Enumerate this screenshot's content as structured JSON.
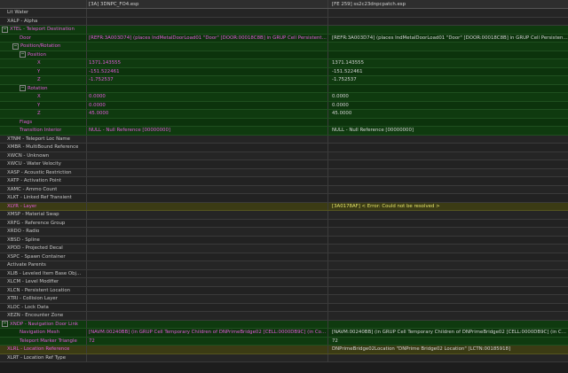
{
  "header": {
    "col1": "[3A] 3DNPC_FO4.esp",
    "col2": "[FE 259] ss2c23dnpcpatch.esp"
  },
  "rows": {
    "r0": {
      "label": "Lit Water",
      "v1": "",
      "v2": ""
    },
    "r1": {
      "label": "XALP - Alpha",
      "v1": "",
      "v2": ""
    },
    "r2": {
      "label": "XTEL - Teleport Destination",
      "v1": "",
      "v2": ""
    },
    "r3": {
      "label": "Door",
      "v1": "[REFR:3A003D74] (places IndMetalDoorLoad01 \"Door\" [DOOR:00018C8B] in GRUP Cell Persistent Chil...",
      "v2": "[REFR:3A003D74] (places IndMetalDoorLoad01 \"Door\" [DOOR:00018C8B] in GRUP Cell Persistent Childr..."
    },
    "r4": {
      "label": "Position/Rotation",
      "v1": "",
      "v2": ""
    },
    "r5": {
      "label": "Position",
      "v1": "",
      "v2": ""
    },
    "r6": {
      "label": "X",
      "v1": "1371.143555",
      "v2": "1371.143555"
    },
    "r7": {
      "label": "Y",
      "v1": "-151.522461",
      "v2": "-151.522461"
    },
    "r8": {
      "label": "Z",
      "v1": "-1.752537",
      "v2": "-1.752537"
    },
    "r9": {
      "label": "Rotation",
      "v1": "",
      "v2": ""
    },
    "r10": {
      "label": "X",
      "v1": "0.0000",
      "v2": "0.0000"
    },
    "r11": {
      "label": "Y",
      "v1": "0.0000",
      "v2": "0.0000"
    },
    "r12": {
      "label": "Z",
      "v1": "45.0000",
      "v2": "45.0000"
    },
    "r13": {
      "label": "Flags",
      "v1": "",
      "v2": ""
    },
    "r14": {
      "label": "Transition Interior",
      "v1": "NULL - Null Reference [00000000]",
      "v2": "NULL - Null Reference [00000000]"
    },
    "r15": {
      "label": "XTNM - Teleport Loc Name",
      "v1": "",
      "v2": ""
    },
    "r16": {
      "label": "XMBR - MultiBound Reference",
      "v1": "",
      "v2": ""
    },
    "r17": {
      "label": "XWCN - Unknown",
      "v1": "",
      "v2": ""
    },
    "r18": {
      "label": "XWCU - Water Velocity",
      "v1": "",
      "v2": ""
    },
    "r19": {
      "label": "XASP - Acoustic Restriction",
      "v1": "",
      "v2": ""
    },
    "r20": {
      "label": "XATP - Activation Point",
      "v1": "",
      "v2": ""
    },
    "r21": {
      "label": "XAMC - Ammo Count",
      "v1": "",
      "v2": ""
    },
    "r22": {
      "label": "XLKT - Linked Ref Transient",
      "v1": "",
      "v2": ""
    },
    "r23": {
      "label": "XLYR - Layer",
      "v1": "",
      "v2": "[3A0178AF] < Error: Could not be resolved >"
    },
    "r24": {
      "label": "XMSP - Material Swap",
      "v1": "",
      "v2": ""
    },
    "r25": {
      "label": "XRFG - Reference Group",
      "v1": "",
      "v2": ""
    },
    "r26": {
      "label": "XRDO - Radio",
      "v1": "",
      "v2": ""
    },
    "r27": {
      "label": "XBSD - Spline",
      "v1": "",
      "v2": ""
    },
    "r28": {
      "label": "XPDD - Projected Decal",
      "v1": "",
      "v2": ""
    },
    "r29": {
      "label": "XSPC - Spawn Container",
      "v1": "",
      "v2": ""
    },
    "r30": {
      "label": "Activate Parents",
      "v1": "",
      "v2": ""
    },
    "r31": {
      "label": "XLIB - Leveled Item Base Obj...",
      "v1": "",
      "v2": ""
    },
    "r32": {
      "label": "XLCM - Level Modifier",
      "v1": "",
      "v2": ""
    },
    "r33": {
      "label": "XLCN - Persistent Location",
      "v1": "",
      "v2": ""
    },
    "r34": {
      "label": "XTRI - Collision Layer",
      "v1": "",
      "v2": ""
    },
    "r35": {
      "label": "XLOC - Lock Data",
      "v1": "",
      "v2": ""
    },
    "r36": {
      "label": "XEZN - Encounter Zone",
      "v1": "",
      "v2": ""
    },
    "r37": {
      "label": "XNDP - Navigation Door Link",
      "v1": "",
      "v2": ""
    },
    "r38": {
      "label": "Navigation Mesh",
      "v1": "[NAVM:00240BB] (in GRUP Cell Temporary Children of DNPrimeBridge02 [CELL:0000DB9C] (in Com...",
      "v2": "[NAVM:00240BB] (in GRUP Cell Temporary Children of DNPrimeBridge02 [CELL:0000DB9C] (in Com..."
    },
    "r39": {
      "label": "Teleport Marker Triangle",
      "v1": "72",
      "v2": "72"
    },
    "r40": {
      "label": "XLRL - Location Reference",
      "v1": "",
      "v2": "DNPrimeBridge02Location \"DNPrime Bridge02 Location\" [LCTN:00185918]"
    },
    "r41": {
      "label": "XLRT - Location Ref Type",
      "v1": "",
      "v2": ""
    }
  },
  "icons": {
    "expand": "minus-box-icon"
  },
  "colors": {
    "conflict_green": "#0f3a0f",
    "conflict_yellow": "#3b3b14",
    "magenta_text": "#e05bd8"
  }
}
